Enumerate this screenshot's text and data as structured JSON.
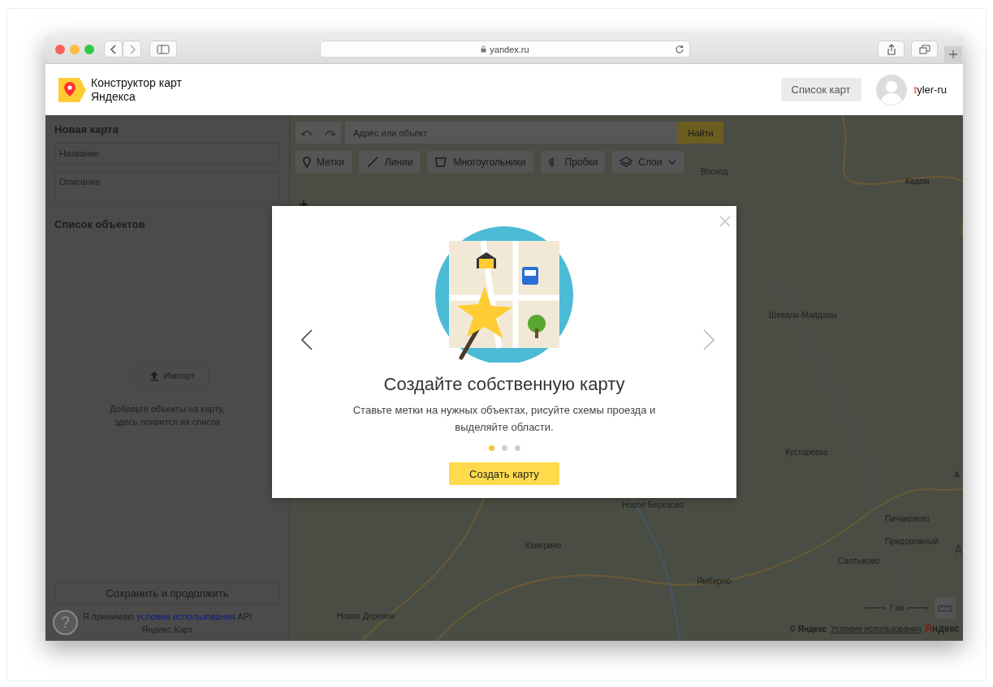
{
  "browser": {
    "url": "yandex.ru"
  },
  "header": {
    "logo": "Конструктор карт Яндекса",
    "maps_button": "Список карт",
    "user": "tyler-ru"
  },
  "sidebar": {
    "title": "Новая карта",
    "name_placeholder": "Название",
    "description_placeholder": "Описание",
    "objects_title": "Список объектов",
    "import_button": "Импорт",
    "empty_hint": "Добавьте объекты на карту, здесь появится их список",
    "save_button": "Сохранить и продолжить",
    "terms_prefix": "Я принимаю",
    "terms_link": "условия использования",
    "terms_suffix": "API Яндекс.Карт",
    "help_button": "?"
  },
  "map": {
    "search_placeholder": "Адрес или объект",
    "search_button": "Найти",
    "tools": [
      {
        "kind": "placemark",
        "label": "Метки"
      },
      {
        "kind": "line",
        "label": "Линии"
      },
      {
        "kind": "polygon",
        "label": "Многоугольники"
      },
      {
        "kind": "traffic",
        "label": "Пробки"
      },
      {
        "kind": "layers",
        "label": "Слои"
      }
    ],
    "zoom_in": "+",
    "places": [
      "Восход",
      "Кадом",
      "Шевали-Майданы",
      "Кустаревка",
      "Новое Берёзово",
      "Пичкиряево",
      "Придорожный",
      "Салтыково",
      "Каверино",
      "Ямбирно",
      "Новая Деревня",
      "А",
      "Д"
    ],
    "scale": "7 км",
    "copyright": "© Яндекс",
    "terms_link": "Условия использования",
    "logo": "Яндекс"
  },
  "modal": {
    "title": "Создайте собственную карту",
    "text": "Ставьте метки на нужных объектах, рисуйте схемы проезда и выделяйте области.",
    "dots": [
      {
        "selected": true
      },
      {
        "selected": false
      },
      {
        "selected": false
      }
    ],
    "button": "Создать карту"
  }
}
